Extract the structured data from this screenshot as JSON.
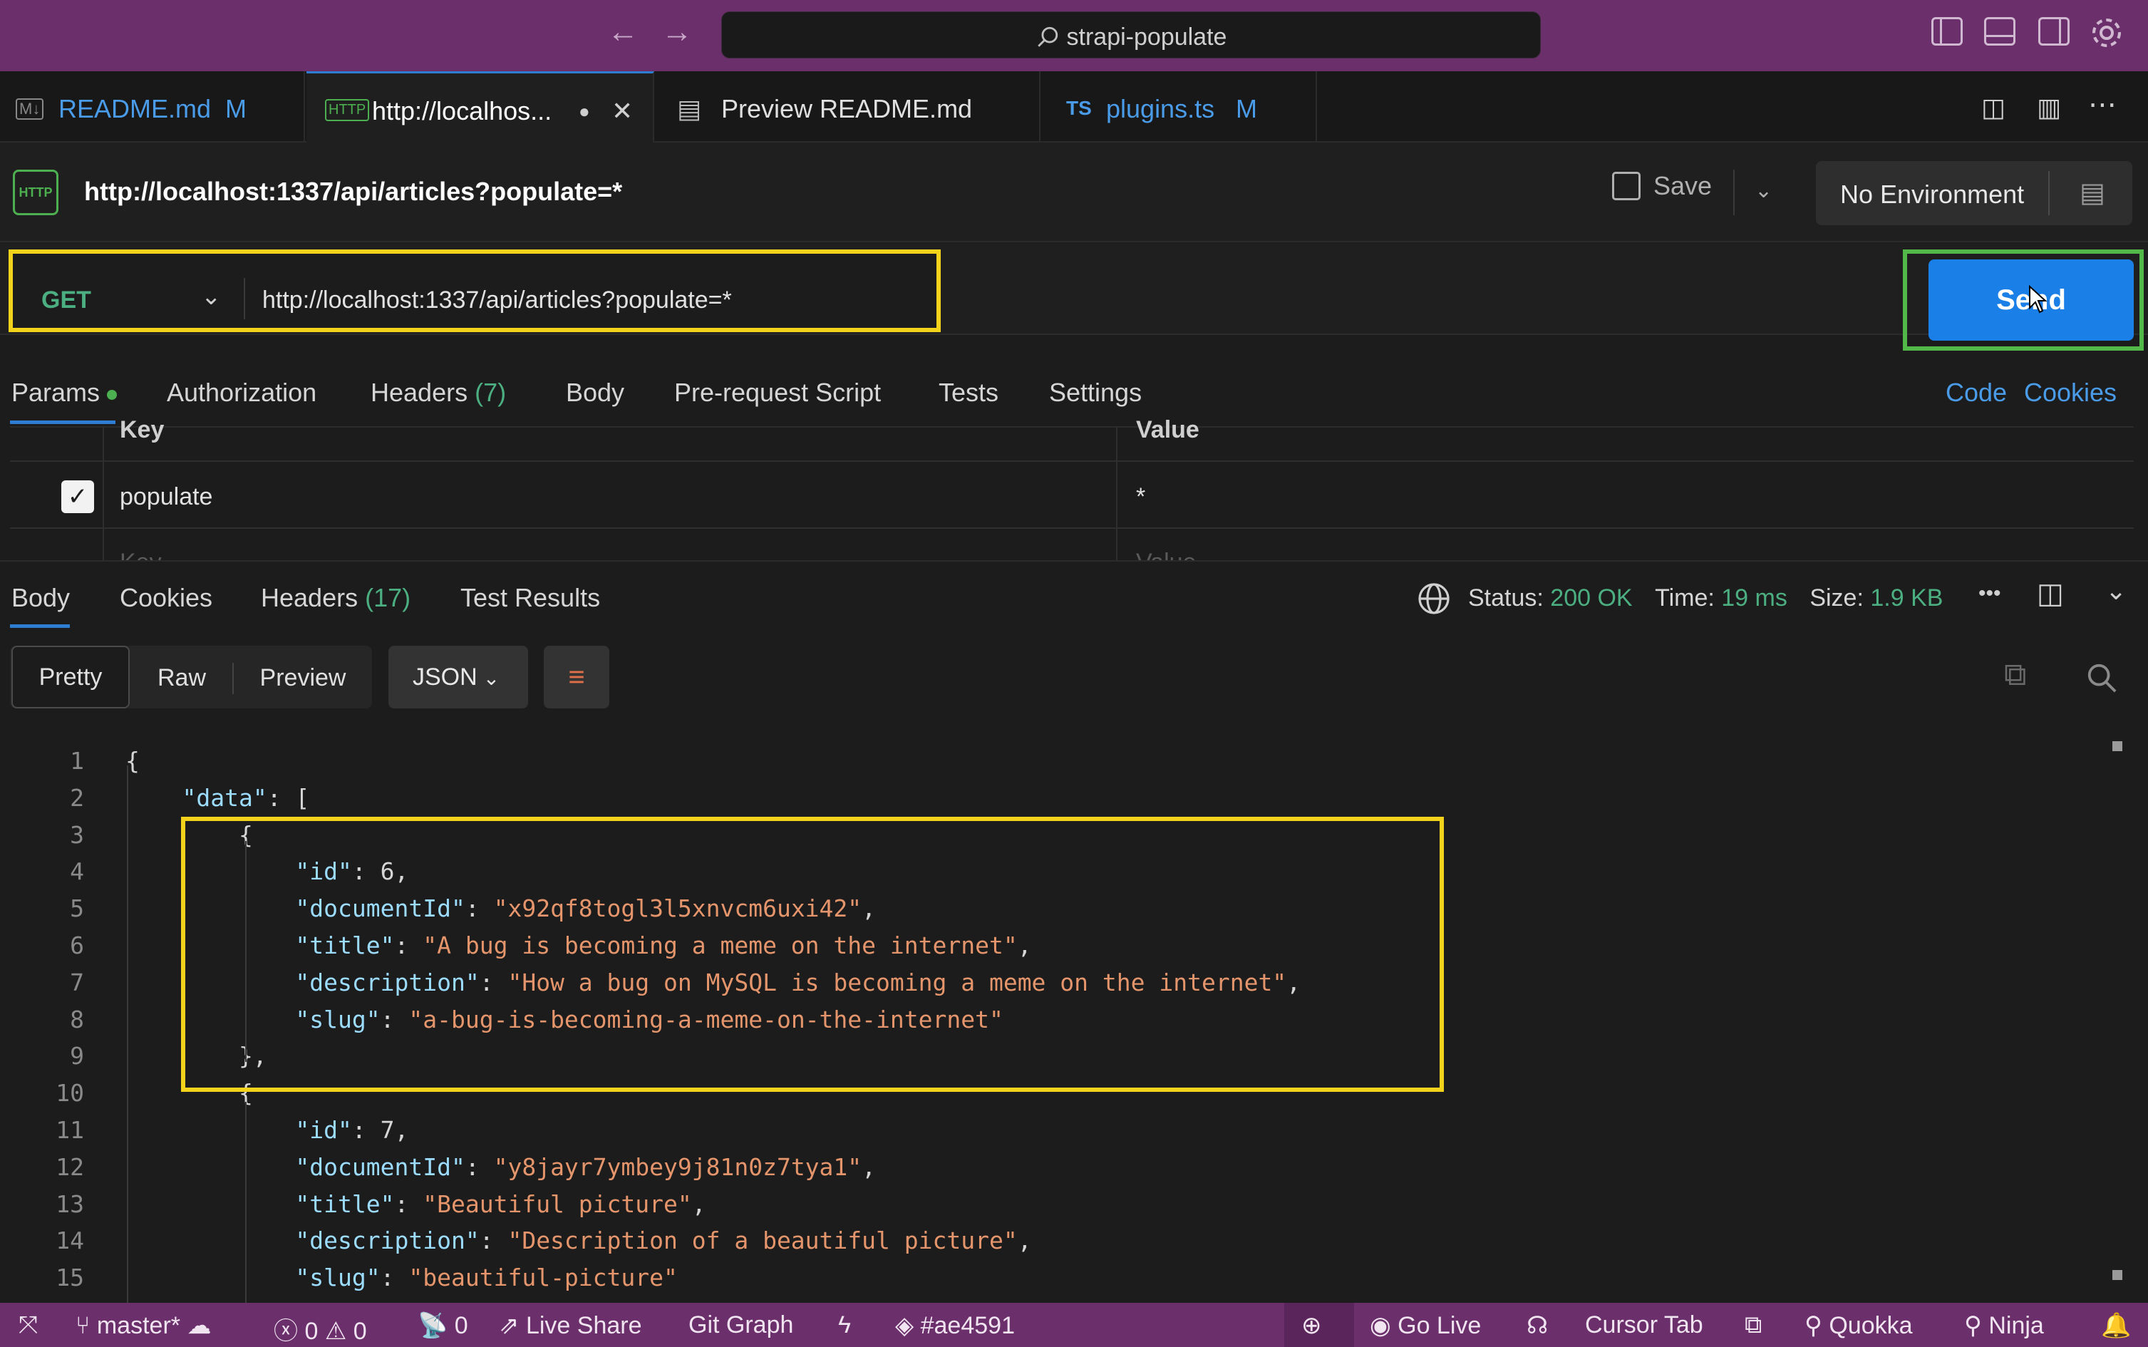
{
  "titlebar": {
    "search_text": "strapi-populate",
    "back_icon": "←",
    "forward_icon": "→"
  },
  "tabs": [
    {
      "icon": "M↓",
      "label": "README.md",
      "badge": "M"
    },
    {
      "icon": "HTTP",
      "label": "http://localhos...",
      "badge": "●"
    },
    {
      "icon": "▤",
      "label": "Preview README.md",
      "badge": ""
    },
    {
      "icon": "TS",
      "label": "plugins.ts",
      "badge": "M"
    }
  ],
  "request": {
    "title": "http://localhost:1337/api/articles?populate=*",
    "save_label": "Save",
    "environment": "No Environment",
    "method": "GET",
    "url": "http://localhost:1337/api/articles?populate=*",
    "send_label": "Send"
  },
  "req_tabs": {
    "params": "Params",
    "authorization": "Authorization",
    "headers": "Headers",
    "headers_count": "(7)",
    "body": "Body",
    "prerequest": "Pre-request Script",
    "tests": "Tests",
    "settings": "Settings",
    "code": "Code",
    "cookies": "Cookies"
  },
  "params_table": {
    "key_header": "Key",
    "value_header": "Value",
    "rows": [
      {
        "key": "populate",
        "value": "*",
        "checked": true
      }
    ],
    "empty_key": "Key",
    "empty_value": "Value"
  },
  "response": {
    "tabs": {
      "body": "Body",
      "cookies": "Cookies",
      "headers": "Headers",
      "headers_count": "(17)",
      "test_results": "Test Results"
    },
    "status_label": "Status:",
    "status_value": "200 OK",
    "time_label": "Time:",
    "time_value": "19 ms",
    "size_label": "Size:",
    "size_value": "1.9 KB",
    "formats": {
      "pretty": "Pretty",
      "raw": "Raw",
      "preview": "Preview",
      "json": "JSON"
    }
  },
  "code_lines": [
    {
      "n": "1",
      "text": "{"
    },
    {
      "n": "2",
      "text": "    \"data\": ["
    },
    {
      "n": "3",
      "text": "        {"
    },
    {
      "n": "4",
      "text": "            \"id\": 6,"
    },
    {
      "n": "5",
      "text": "            \"documentId\": \"x92qf8togl3l5xnvcm6uxi42\","
    },
    {
      "n": "6",
      "text": "            \"title\": \"A bug is becoming a meme on the internet\","
    },
    {
      "n": "7",
      "text": "            \"description\": \"How a bug on MySQL is becoming a meme on the internet\","
    },
    {
      "n": "8",
      "text": "            \"slug\": \"a-bug-is-becoming-a-meme-on-the-internet\""
    },
    {
      "n": "9",
      "text": "        },"
    },
    {
      "n": "10",
      "text": "        {"
    },
    {
      "n": "11",
      "text": "            \"id\": 7,"
    },
    {
      "n": "12",
      "text": "            \"documentId\": \"y8jayr7ymbey9j81n0z7tya1\","
    },
    {
      "n": "13",
      "text": "            \"title\": \"Beautiful picture\","
    },
    {
      "n": "14",
      "text": "            \"description\": \"Description of a beautiful picture\","
    },
    {
      "n": "15",
      "text": "            \"slug\": \"beautiful-picture\""
    }
  ],
  "statusbar": {
    "branch": "master*",
    "errors": "0",
    "warnings": "0",
    "ports": "0",
    "live_share": "Live Share",
    "git_graph": "Git Graph",
    "color": "#ae4591",
    "go_live": "Go Live",
    "cursor_tab": "Cursor Tab",
    "quokka": "Quokka",
    "ninja": "Ninja"
  },
  "colors": {
    "titlebar": "#6b2f6b",
    "accent": "#2d7dd2",
    "send": "#1a7fe6",
    "highlight_yellow": "#f2d21b",
    "highlight_green": "#52b848",
    "status_ok": "#4caf82"
  }
}
